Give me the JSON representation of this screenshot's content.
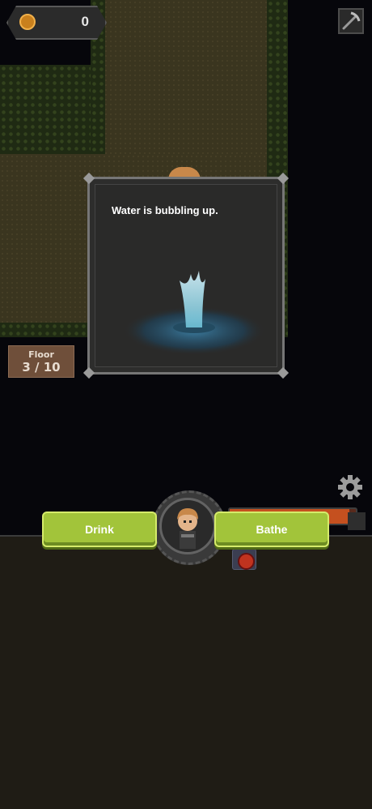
{
  "hud": {
    "coin_count": "0",
    "coin_icon": "coin-icon",
    "tool_icon": "pickaxe-icon",
    "settings_icon": "gear-icon"
  },
  "floor": {
    "label": "Floor",
    "value": "3 / 10"
  },
  "event": {
    "message": "Water is bubbling up.",
    "image": "water-fountain"
  },
  "actions": {
    "drink_label": "Drink",
    "bathe_label": "Bathe"
  },
  "player": {
    "portrait": "hero-portrait",
    "hp_fraction": 0.95,
    "potion_icon": "red-potion-icon"
  },
  "colors": {
    "button_green": "#a2c43a",
    "hp_orange": "#c5501f",
    "coin_gold": "#c9801d"
  }
}
